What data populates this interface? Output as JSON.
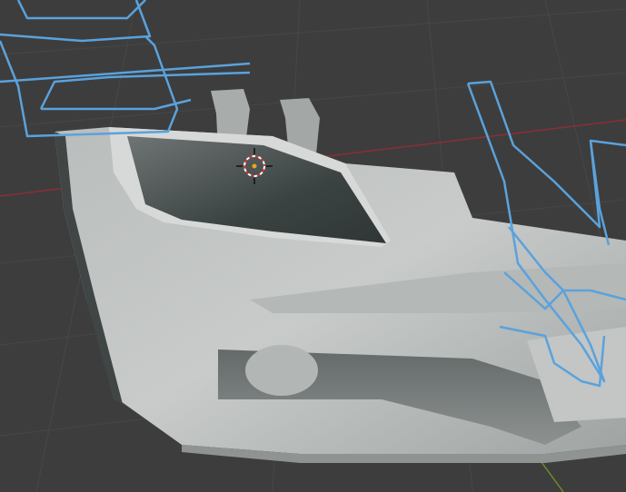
{
  "viewport": {
    "mode": "3D viewport",
    "colors": {
      "background": "#3d3d3d",
      "grid": "#464646",
      "x_axis": "#8a2e36",
      "y_axis": "#6a8a2a",
      "reference_curves": "#5aa2dc",
      "mesh_light": "#c9cbcb",
      "mesh_mid": "#a9adad",
      "mesh_dark": "#3f4645"
    },
    "icons": [
      "3d-cursor-icon"
    ]
  }
}
